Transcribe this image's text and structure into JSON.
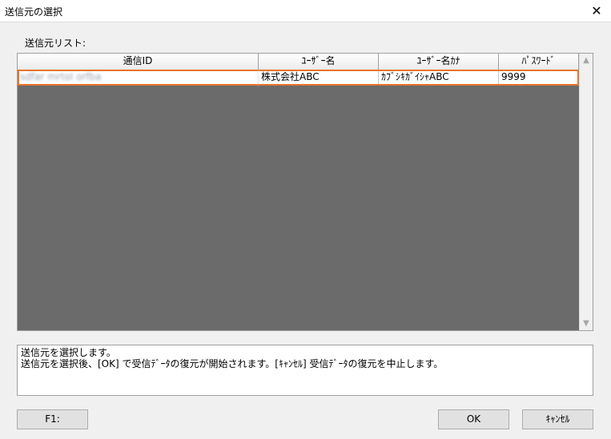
{
  "window": {
    "title": "送信元の選択",
    "close_symbol": "✕"
  },
  "list_label": "送信元リスト:",
  "table": {
    "columns": [
      "通信ID",
      "ﾕｰｻﾞｰ名",
      "ﾕｰｻﾞｰ名ｶﾅ",
      "ﾊﾟｽﾜｰﾄﾞ"
    ],
    "rows": [
      {
        "id": "sdfar mrtol orfba",
        "user_name": "株式会社ABC",
        "user_kana": "ｶﾌﾞｼｷｶﾞｲｼｬABC",
        "password": "9999"
      }
    ]
  },
  "message": {
    "line1": "送信元を選択します。",
    "line2": "送信元を選択後、[OK] で受信ﾃﾞｰﾀの復元が開始されます。[ｷｬﾝｾﾙ] 受信ﾃﾞｰﾀの復元を中止します。"
  },
  "buttons": {
    "f1": "F1:",
    "ok": "OK",
    "cancel": "ｷｬﾝｾﾙ"
  },
  "colors": {
    "selection_outline": "#e8752a",
    "grid_background": "#6b6b6b"
  }
}
